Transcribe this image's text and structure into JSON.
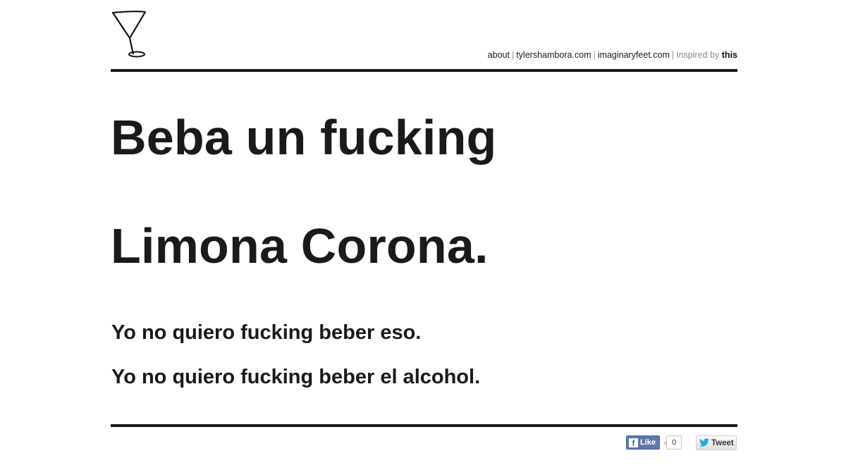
{
  "header": {
    "logo_icon": "martini-glass-icon",
    "nav": {
      "about": "about",
      "site1": "tylershambora.com",
      "site2": "imaginaryfeet.com",
      "inspired_prefix": "Inspired by",
      "inspired_link": "this",
      "separator": "|"
    }
  },
  "main": {
    "headline_line1": "Beba un fucking",
    "headline_line2": "Limona Corona.",
    "subline1": "Yo no quiero fucking beber eso.",
    "subline2": "Yo no quiero fucking beber el alcohol."
  },
  "footer": {
    "like_icon": "facebook-icon",
    "like_label": "Like",
    "like_count": "0",
    "tweet_icon": "twitter-bird-icon",
    "tweet_label": "Tweet"
  },
  "colors": {
    "text": "#1a1a1a",
    "rule": "#1a1a1a",
    "facebook": "#5f78ab",
    "twitter": "#2aa9e0"
  }
}
